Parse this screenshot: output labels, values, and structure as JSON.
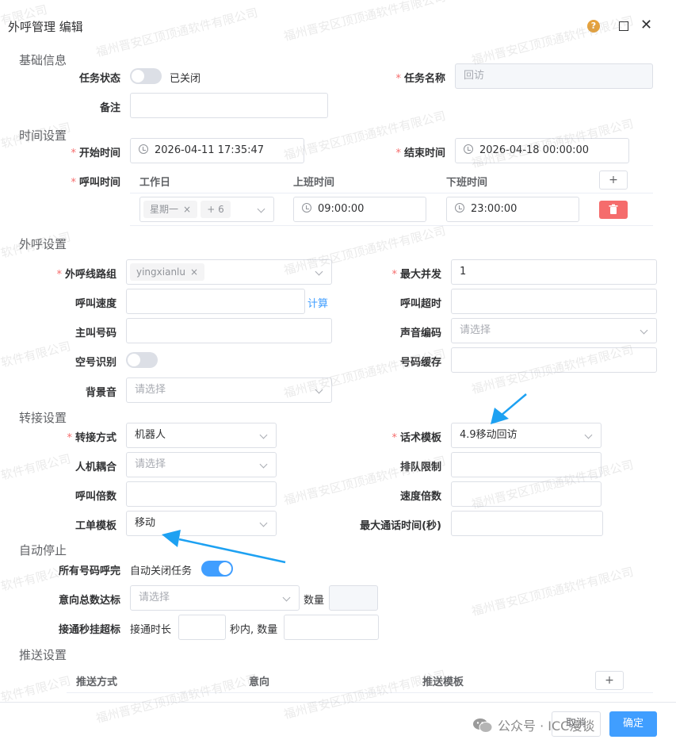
{
  "dialog": {
    "title": "外呼管理 编辑",
    "help_glyph": "?",
    "close_glyph": "✕"
  },
  "sections": {
    "basic": "基础信息",
    "time": "时间设置",
    "outbound": "外呼设置",
    "transfer": "转接设置",
    "auto_stop": "自动停止",
    "push": "推送设置"
  },
  "basic": {
    "task_status_label": "任务状态",
    "task_status_value": "已关闭",
    "task_name_label": "任务名称",
    "task_name_value": "回访",
    "remark_label": "备注",
    "remark_value": ""
  },
  "time": {
    "start_label": "开始时间",
    "start_value": "2026-04-11 17:35:47",
    "end_label": "结束时间",
    "end_value": "2026-04-18 00:00:00",
    "call_time_label": "呼叫时间",
    "col_workday": "工作日",
    "col_on": "上班时间",
    "col_off": "下班时间",
    "add_glyph": "+",
    "workday_tag": "星期一",
    "workday_more": "+ 6",
    "on_value": "09:00:00",
    "off_value": "23:00:00",
    "tag_close": "×"
  },
  "outbound": {
    "line_group_label": "外呼线路组",
    "line_group_tag": "yingxianlu",
    "max_concurrency_label": "最大并发",
    "max_concurrency_value": "1",
    "call_speed_label": "呼叫速度",
    "call_speed_value": "",
    "calc_link": "计算",
    "call_timeout_label": "呼叫超时",
    "call_timeout_value": "",
    "caller_label": "主叫号码",
    "caller_value": "",
    "codec_label": "声音编码",
    "codec_placeholder": "请选择",
    "empty_detect_label": "空号识别",
    "number_cache_label": "号码缓存",
    "number_cache_value": "",
    "bg_sound_label": "背景音",
    "bg_sound_placeholder": "请选择"
  },
  "transfer": {
    "mode_label": "转接方式",
    "mode_value": "机器人",
    "script_label": "话术模板",
    "script_value": "4.9移动回访",
    "coupling_label": "人机耦合",
    "coupling_placeholder": "请选择",
    "queue_limit_label": "排队限制",
    "queue_limit_value": "",
    "call_multiple_label": "呼叫倍数",
    "call_multiple_value": "",
    "speed_multiple_label": "速度倍数",
    "speed_multiple_value": "",
    "ticket_label": "工单模板",
    "ticket_value": "移动",
    "max_talk_label": "最大通话时间(秒)",
    "max_talk_value": ""
  },
  "auto_stop": {
    "all_called_label": "所有号码呼完",
    "auto_close_text": "自动关闭任务",
    "intent_label": "意向总数达标",
    "intent_placeholder": "请选择",
    "count_text": "数量",
    "connect_label": "接通秒挂超标",
    "connect_duration_text": "接通时长",
    "within_count_text": "秒内, 数量"
  },
  "push": {
    "col_method": "推送方式",
    "col_intent": "意向",
    "col_template": "推送模板",
    "add_glyph": "+"
  },
  "footer": {
    "cancel_label": "取消",
    "confirm_label": "确定"
  },
  "overlay": {
    "wechat_text": "公众号 · ICC漫谈",
    "watermark": "福州晋安区顶顶通软件有限公司",
    "watermark_short": "软件有限公司",
    "watermark_tail": "有限公司"
  },
  "colors": {
    "primary": "#409eff",
    "danger": "#f56c6c",
    "required": "#f56c6c",
    "arrow": "#1da1f2"
  }
}
